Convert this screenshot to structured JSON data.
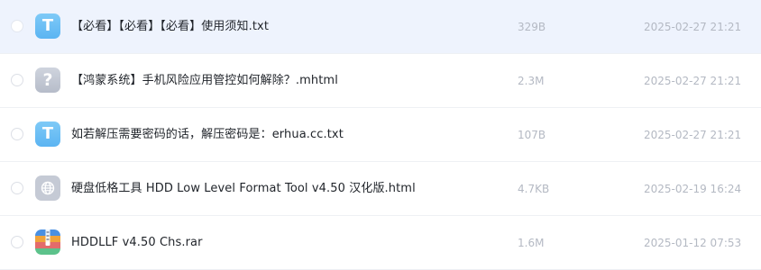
{
  "files": [
    {
      "name": "【必看】【必看】【必看】使用须知.txt",
      "size": "329B",
      "date": "2025-02-27 21:21",
      "icon": "txt-file-icon",
      "icon_glyph": "T",
      "selected": true
    },
    {
      "name": "【鸿蒙系统】手机风险应用管控如何解除？.mhtml",
      "size": "2.3M",
      "date": "2025-02-27 21:21",
      "icon": "unknown-file-icon",
      "icon_glyph": "?",
      "selected": false
    },
    {
      "name": "如若解压需要密码的话，解压密码是：erhua.cc.txt",
      "size": "107B",
      "date": "2025-02-27 21:21",
      "icon": "txt-file-icon",
      "icon_glyph": "T",
      "selected": false
    },
    {
      "name": "硬盘低格工具 HDD Low Level Format Tool v4.50 汉化版.html",
      "size": "4.7KB",
      "date": "2025-02-19 16:24",
      "icon": "html-file-icon",
      "icon_glyph": "",
      "selected": false
    },
    {
      "name": "HDDLLF v4.50 Chs.rar",
      "size": "1.6M",
      "date": "2025-01-12 07:53",
      "icon": "rar-archive-icon",
      "icon_glyph": "",
      "selected": false
    }
  ],
  "colors": {
    "selected_row_bg": "#eef3fd",
    "txt_icon": "#5bb4f2",
    "unknown_icon": "#b6bcc9",
    "html_icon": "#c5cad5",
    "meta_text": "#b4b9c3",
    "name_text": "#1f2329"
  }
}
